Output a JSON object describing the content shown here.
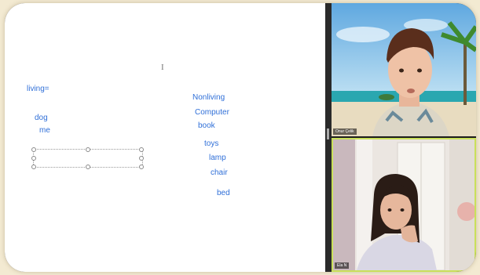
{
  "whiteboard": {
    "living_label": "living=",
    "living_items": [
      "dog",
      "me"
    ],
    "nonliving_label": "Nonliving",
    "nonliving_items": [
      "Computer",
      "book",
      "toys",
      "lamp",
      "chair",
      "bed"
    ],
    "cursor_glyph": "I"
  },
  "participants": [
    {
      "name": "Onur Çelik"
    },
    {
      "name": "Ela N"
    }
  ],
  "colors": {
    "ink": "#2f6fd8",
    "active_speaker_border": "#c9e05a"
  }
}
